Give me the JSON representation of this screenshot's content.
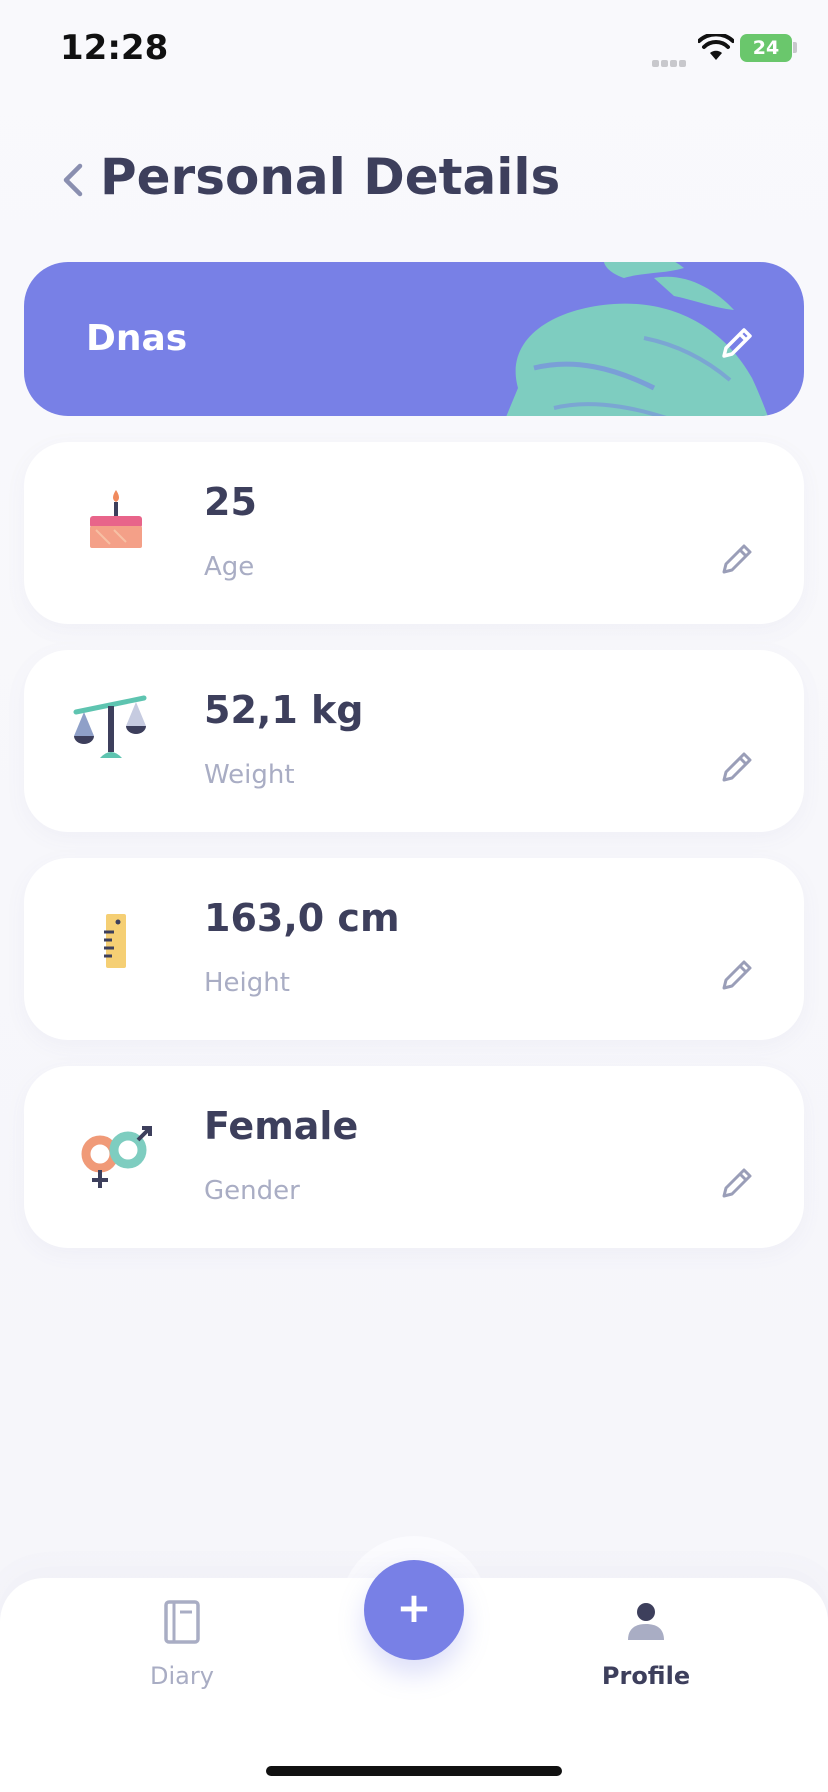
{
  "status_bar": {
    "time": "12:28",
    "battery": "24"
  },
  "header": {
    "title": "Personal Details"
  },
  "name_card": {
    "name": "Dnas"
  },
  "details": [
    {
      "value": "25",
      "label": "Age",
      "icon": "birthday-cake-icon"
    },
    {
      "value": "52,1 kg",
      "label": "Weight",
      "icon": "scale-icon"
    },
    {
      "value": "163,0 cm",
      "label": "Height",
      "icon": "ruler-icon"
    },
    {
      "value": "Female",
      "label": "Gender",
      "icon": "gender-icon"
    }
  ],
  "nav": {
    "diary_label": "Diary",
    "add_label": "+",
    "profile_label": "Profile"
  },
  "colors": {
    "accent": "#7880e6",
    "teal": "#7ecdc0",
    "text_dark": "#3d3f5c",
    "text_muted": "#a9adc4"
  }
}
